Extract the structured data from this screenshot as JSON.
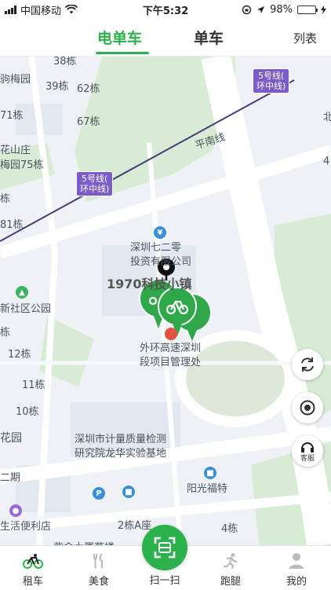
{
  "status_bar": {
    "carrier": "中国移动",
    "time": "下午5:32",
    "battery": "98%",
    "battery_level": 0.98
  },
  "tabs": {
    "ebike": "电单车",
    "bike": "单车",
    "list": "列表"
  },
  "map": {
    "metro_labels": [
      "5号线(\n环中线)",
      "5号线(\n环中线)"
    ],
    "labels": {
      "b38": "38栋",
      "meiyuan": "驹梅园",
      "b39": "39栋",
      "b62": "62栋",
      "b71": "71栋",
      "b67": "67栋",
      "huashan": "花山庄",
      "meiyuan75": "梅园75栋",
      "pingnan": "平南线",
      "cao": "栋",
      "b81": "81栋",
      "company1": "深圳七二零",
      "company2": "投资有限公司",
      "town": "1970科技小镇",
      "community": "新社区公园",
      "b_stub": "栋",
      "b12": "12栋",
      "b11": "11栋",
      "b10": "10栋",
      "hw1": "外环高速深圳",
      "hw2": "段项目管理处",
      "huayuan": "花园",
      "phase2": "二期",
      "inst1": "深圳市计量质量检测",
      "inst2": "研究院龙华实验基地",
      "yangguang": "阳光福特",
      "life": "生活便利店",
      "b2a": "2栋A座",
      "b4": "4栋",
      "bottom_cut": "紫金大厦草楼",
      "north": "北",
      "r4": "4"
    }
  },
  "controls": {
    "service_label": "客服"
  },
  "bottom_nav": {
    "rent": "租车",
    "food": "美食",
    "scan": "扫一扫",
    "errand": "跑腿",
    "mine": "我的"
  },
  "colors": {
    "accent": "#2bb24c",
    "metro": "#7b5cc8"
  }
}
